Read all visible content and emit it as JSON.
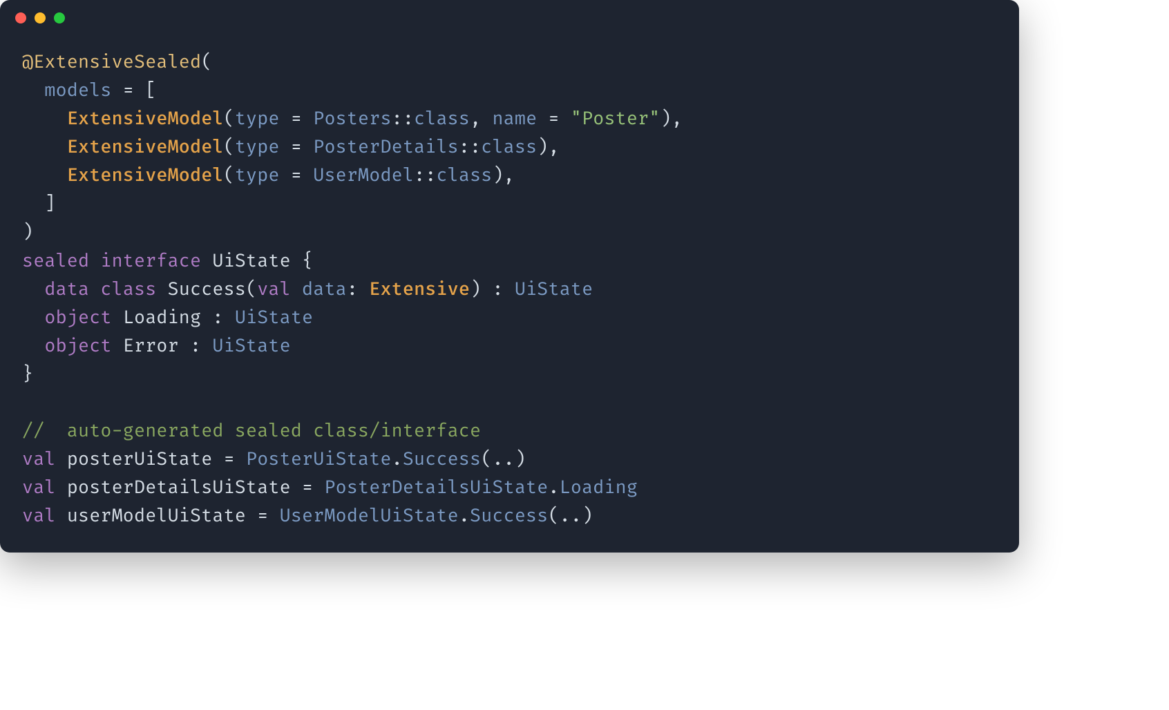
{
  "code": {
    "annotation": "@ExtensiveSealed",
    "open_paren": "(",
    "models_param": "models",
    "eq": " = ",
    "open_bracket": "[",
    "model_class": "ExtensiveModel",
    "type_param": "type",
    "posters_type": "Posters",
    "coloncolon": "::",
    "class_kw": "class",
    "comma": ",",
    "name_param": "name",
    "string_open": "\"",
    "poster_str": "Poster",
    "string_close": "\"",
    "posterdetails_type": "PosterDetails",
    "usermodel_type": "UserModel",
    "close_bracket": "]",
    "close_paren": ")",
    "sealed_kw": "sealed",
    "interface_kw": "interface",
    "uistate": "UiState",
    "open_brace": "{",
    "data_kw": "data",
    "class_kw2": "class",
    "success": "Success",
    "val_kw": "val",
    "data_id": "data",
    "colon": ":",
    "extensive_type": "Extensive",
    "object_kw": "object",
    "loading": "Loading",
    "error": "Error",
    "close_brace": "}",
    "comment": "//  auto-generated sealed class/interface",
    "posteruistate_var": "posterUiState",
    "posteruistate_type": "PosterUiState",
    "dot": ".",
    "dots": "..",
    "posterdetailsuistate_var": "posterDetailsUiState",
    "posterdetailsuistate_type": "PosterDetailsUiState",
    "loading_member": "Loading",
    "usermodeluistate_var": "userModelUiState",
    "usermodeluistate_type": "UserModelUiState"
  }
}
